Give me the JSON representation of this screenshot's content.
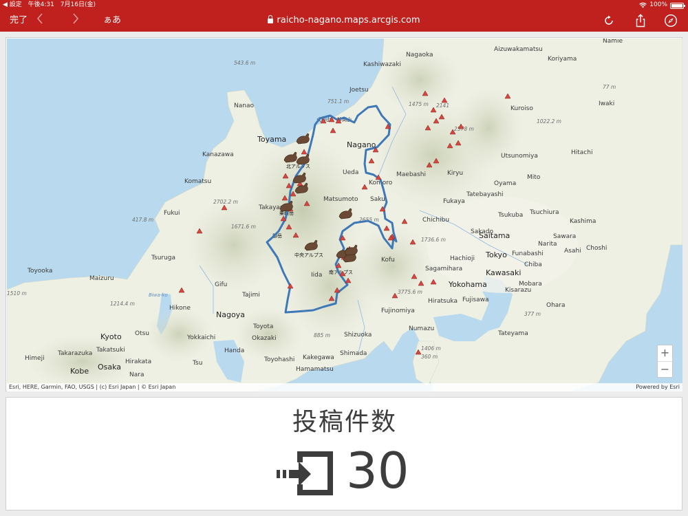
{
  "status": {
    "back_app": "◀ 設定",
    "time": "午後4:31",
    "date": "7月16日(金)",
    "battery": "100%",
    "battery_level": 1.0
  },
  "toolbar": {
    "done_label": "完了",
    "back_icon": "chevron-left-icon",
    "forward_icon": "chevron-right-icon",
    "reader_label": "ぁあ",
    "url": "raicho-nagano.maps.arcgis.com",
    "reload_icon": "reload-icon",
    "share_icon": "share-icon",
    "compass_icon": "compass-icon",
    "accent": "#c0211e"
  },
  "map": {
    "labels": {
      "nagaoka": "Nagaoka",
      "aizuwakamatsu": "Aizuwakamatsu",
      "namie": "Namie",
      "kashiwazaki": "Kashiwazaki",
      "koriyama": "Koriyama",
      "joetsu": "Joetsu",
      "iwaki": "Iwaki",
      "nanao": "Nanao",
      "kuroiso": "Kuroiso",
      "toyama": "Toyama",
      "nagano": "Nagano",
      "hitachi": "Hitachi",
      "kanazawa": "Kanazawa",
      "utsunomiya": "Utsunomiya",
      "ueda": "Ueda",
      "maebashi": "Maebashi",
      "kiryu": "Kiryu",
      "mito": "Mito",
      "komatsu": "Komatsu",
      "komoro": "Komoro",
      "oyama": "Oyama",
      "tatebayashi": "Tatebayashi",
      "matsumoto": "Matsumoto",
      "saku": "Saku",
      "fukaya": "Fukaya",
      "fukui": "Fukui",
      "takayama": "Takayama",
      "tsukuba": "Tsukuba",
      "tsuchiura": "Tsuchiura",
      "chichibu": "Chichibu",
      "kashima": "Kashima",
      "sakado": "Sakado",
      "saitama": "Saitama",
      "sawara": "Sawara",
      "narita": "Narita",
      "choshi": "Choshi",
      "asahi": "Asahi",
      "funabashi": "Funabashi",
      "tsuruga": "Tsuruga",
      "kofu": "Kofu",
      "hachioji": "Hachioji",
      "tokyo": "Tokyo",
      "chiba": "Chiba",
      "sagamihara": "Sagamihara",
      "toyooka": "Toyooka",
      "maizuru": "Maizuru",
      "iida": "Iida",
      "kawasaki": "Kawasaki",
      "yokohama": "Yokohama",
      "mobara": "Mobara",
      "gifu": "Gifu",
      "kisarazu": "Kisarazu",
      "tajimi": "Tajimi",
      "hiratsuka": "Hiratsuka",
      "fujisawa": "Fujisawa",
      "ohara": "Ohara",
      "hikone": "Hikone",
      "nagoya": "Nagoya",
      "fujinomiya": "Fujinomiya",
      "toyota": "Toyota",
      "kyoto": "Kyoto",
      "otsu": "Otsu",
      "yokkaichi": "Yokkaichi",
      "okazaki": "Okazaki",
      "shizuoka": "Shizuoka",
      "numazu": "Numazu",
      "tateyama": "Tateyama",
      "himeji": "Himeji",
      "takarazuka": "Takarazuka",
      "takatsuki": "Takatsuki",
      "hirakata": "Hirakata",
      "tsu": "Tsu",
      "handa": "Handa",
      "toyohashi": "Toyohashi",
      "kakegawa": "Kakegawa",
      "shimada": "Shimada",
      "kobe": "Kobe",
      "osaka": "Osaka",
      "nara": "Nara",
      "hamamatsu": "Hamamatsu",
      "biwako": "Biwa-ko",
      "hiuchiyama": "火打山",
      "myoko": "妙高山",
      "kita_alps": "北アルプス",
      "norikura": "乗鞍岳",
      "ontake": "御岳",
      "chuo_alps": "中央アルプス",
      "minami_alps": "南アルプス",
      "e543": "543.6 m",
      "e751": "751.1 m",
      "e1475": "1475 m",
      "e2141": "2141",
      "e1022": "1022.2 m",
      "e2578": "2578 m",
      "e77": "77 m",
      "e2702": "2702.2 m",
      "e417": "417.8 m",
      "e1671": "1671.6 m",
      "e2655": "2655 m",
      "e1736": "1736.6 m",
      "e1510": "1510 m",
      "e1214": "1214.4 m",
      "e3775": "3775.6 m",
      "e377": "377 m",
      "e885": "885 m",
      "e1406": "1406 m",
      "e360": "360 m"
    },
    "zoom_in": "+",
    "zoom_out": "−",
    "attribution": "Esri, HERE, Garmin, FAO, USGS | (c) Esri Japan | © Esri Japan",
    "powered_by": "Powered by Esri",
    "colors": {
      "sea": "#b9d9ef",
      "land": "#eef0e4",
      "mountain_marker": "#d9463f",
      "boundary": "#3f78b6",
      "bird": "#6b4a35"
    }
  },
  "count": {
    "title": "投稿件数",
    "icon": "sign-in-icon",
    "value": "30",
    "text_color": "#3d3d3d"
  }
}
